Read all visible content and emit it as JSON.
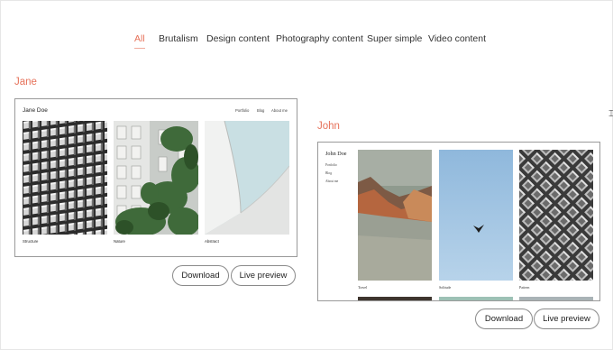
{
  "filters": {
    "items": [
      {
        "label": "All",
        "active": true
      },
      {
        "label": "Brutalism",
        "active": false
      },
      {
        "label": "Design content",
        "active": false
      },
      {
        "label": "Photography content",
        "active": false
      },
      {
        "label": "Super simple",
        "active": false
      },
      {
        "label": "Video content",
        "active": false
      }
    ]
  },
  "templates": {
    "jane": {
      "name": "Jane",
      "site_title": "Jane Doe",
      "nav": [
        "Portfolio",
        "Blog",
        "About me"
      ],
      "captions": [
        "Structure",
        "Nature",
        "Abstract"
      ],
      "download_label": "Download",
      "preview_label": "Live preview"
    },
    "john": {
      "name": "John",
      "site_title": "John Doe",
      "nav": [
        "Portfolio",
        "Blog",
        "About me"
      ],
      "captions": [
        "Travel",
        "Solitude",
        "Pattern"
      ],
      "download_label": "Download",
      "preview_label": "Live preview"
    }
  },
  "colors": {
    "accent": "#e6725a",
    "text": "#333333",
    "border": "#9a9a9a"
  }
}
